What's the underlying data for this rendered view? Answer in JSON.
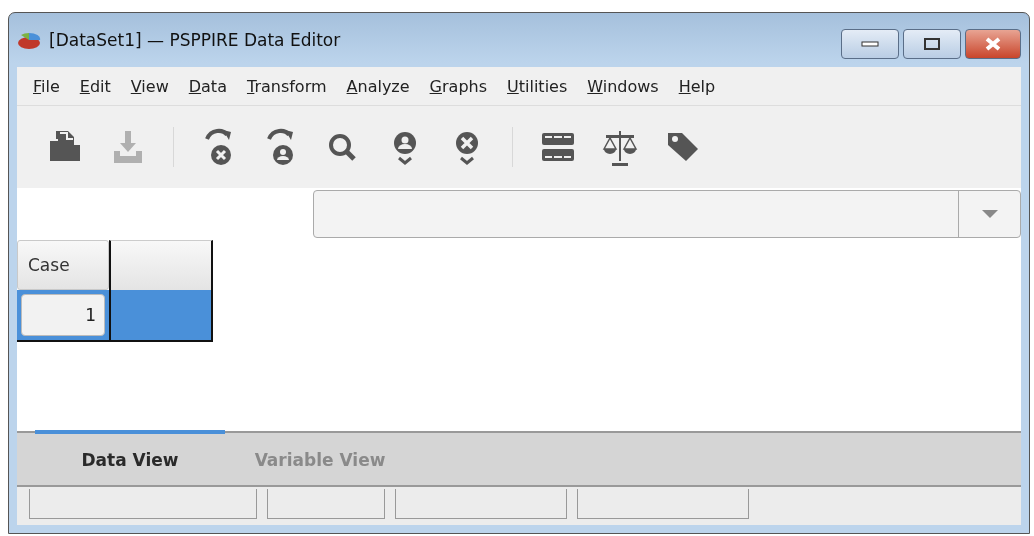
{
  "window": {
    "title": "[DataSet1] — PSPPIRE Data Editor"
  },
  "menu": [
    {
      "label": "File"
    },
    {
      "label": "Edit"
    },
    {
      "label": "View"
    },
    {
      "label": "Data"
    },
    {
      "label": "Transform"
    },
    {
      "label": "Analyze"
    },
    {
      "label": "Graphs"
    },
    {
      "label": "Utilities"
    },
    {
      "label": "Windows"
    },
    {
      "label": "Help"
    }
  ],
  "toolbar": [
    {
      "kind": "open",
      "disabled": false
    },
    {
      "kind": "save",
      "disabled": true
    },
    {
      "kind": "separator"
    },
    {
      "kind": "goto-case",
      "disabled": false
    },
    {
      "kind": "goto-variable",
      "disabled": false
    },
    {
      "kind": "find",
      "disabled": false
    },
    {
      "kind": "insert-case",
      "disabled": false
    },
    {
      "kind": "insert-variable",
      "disabled": false
    },
    {
      "kind": "separator"
    },
    {
      "kind": "split",
      "disabled": false
    },
    {
      "kind": "weight",
      "disabled": false
    },
    {
      "kind": "label",
      "disabled": false
    }
  ],
  "grid": {
    "columns": [
      "Case"
    ],
    "rows": [
      {
        "case": "1",
        "selected": true
      }
    ]
  },
  "tabs": [
    {
      "label": "Data View",
      "selected": true
    },
    {
      "label": "Variable View",
      "selected": false
    }
  ]
}
